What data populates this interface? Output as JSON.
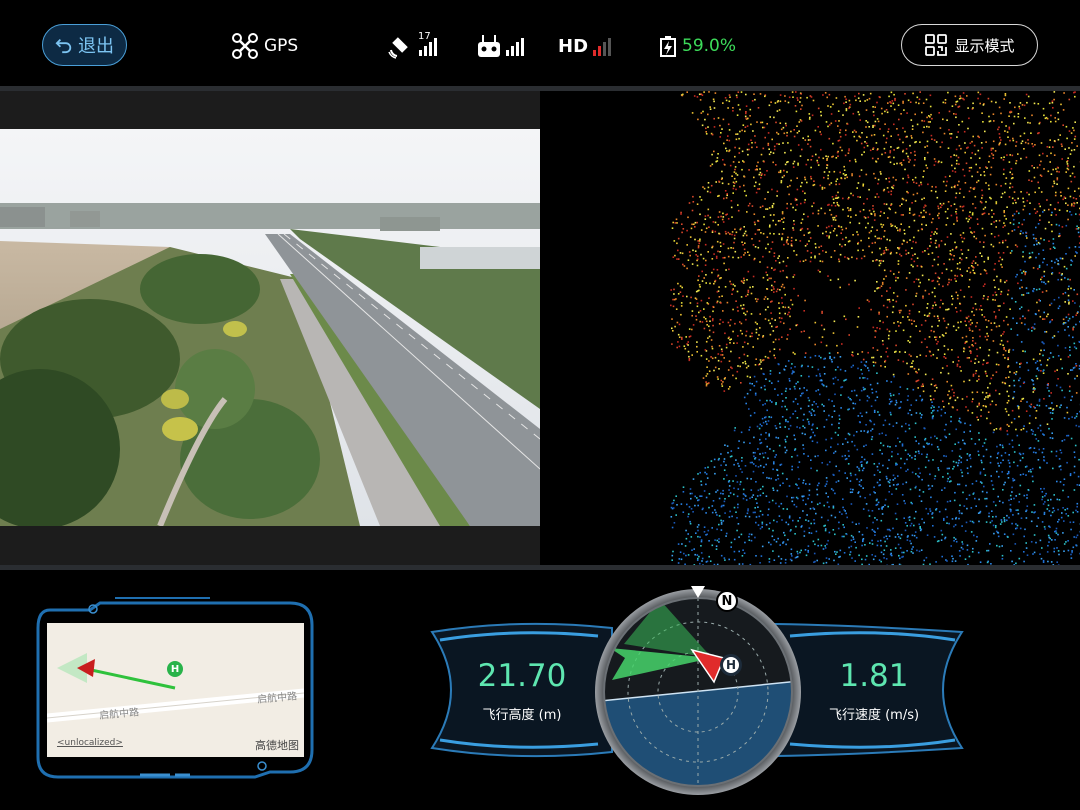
{
  "topbar": {
    "exit_label": "退出",
    "gps_label": "GPS",
    "satellite_count": "17",
    "hd_label": "HD",
    "battery_percent": "59.0%",
    "display_mode_label": "显示模式"
  },
  "signals": {
    "satellite_bars": 4,
    "remote_bars": 4,
    "hd_bars_active": 2,
    "hd_bars_total": 4
  },
  "colors": {
    "accent_blue": "#4a9fd8",
    "battery_green": "#3ddb5a",
    "readout_green": "#5ee6b0",
    "signal_red": "#e02b2b"
  },
  "minimap": {
    "road_label_1": "启航中路",
    "road_label_2": "启航中路",
    "unlocalized": "<unlocalized>",
    "brand": "高德地图",
    "home_marker": "H"
  },
  "flight": {
    "altitude_value": "21.70",
    "altitude_label": "飞行高度 (m)",
    "speed_value": "1.81",
    "speed_label": "飞行速度 (m/s)"
  },
  "attitude": {
    "north_label": "N",
    "home_label": "H"
  },
  "icons": {
    "exit": "undo-arrow-icon",
    "gps": "drone-icon",
    "satellite": "satellite-icon",
    "remote": "remote-controller-icon",
    "battery": "battery-icon",
    "display": "grid-layout-icon"
  }
}
